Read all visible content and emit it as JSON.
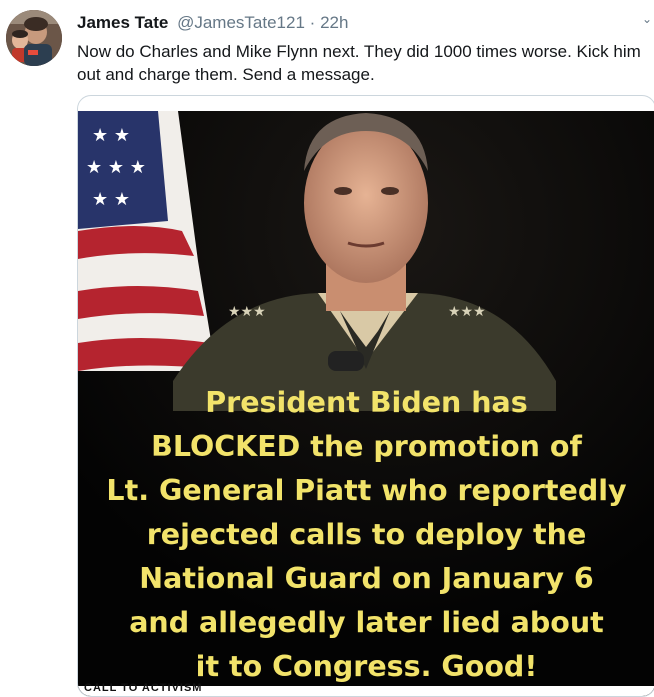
{
  "tweet": {
    "author_name": "James Tate",
    "handle": "@JamesTate121",
    "separator": "·",
    "time": "22h",
    "text": "Now do Charles and Mike Flynn next. They did 1000 times worse. Kick him out and charge them. Send a message.",
    "avatar_icon": "profile-photo",
    "menu_icon": "chevron-down-icon"
  },
  "media": {
    "caption_lines": [
      "President Biden has",
      "BLOCKED the promotion of",
      "Lt. General Piatt who reportedly",
      "rejected calls to deploy the",
      "National Guard on January 6",
      "and allegedly later lied about",
      "it to Congress. Good!"
    ],
    "caption_color": "#f2e36a",
    "footer_partial": "CALL TO ACTIVISM"
  }
}
